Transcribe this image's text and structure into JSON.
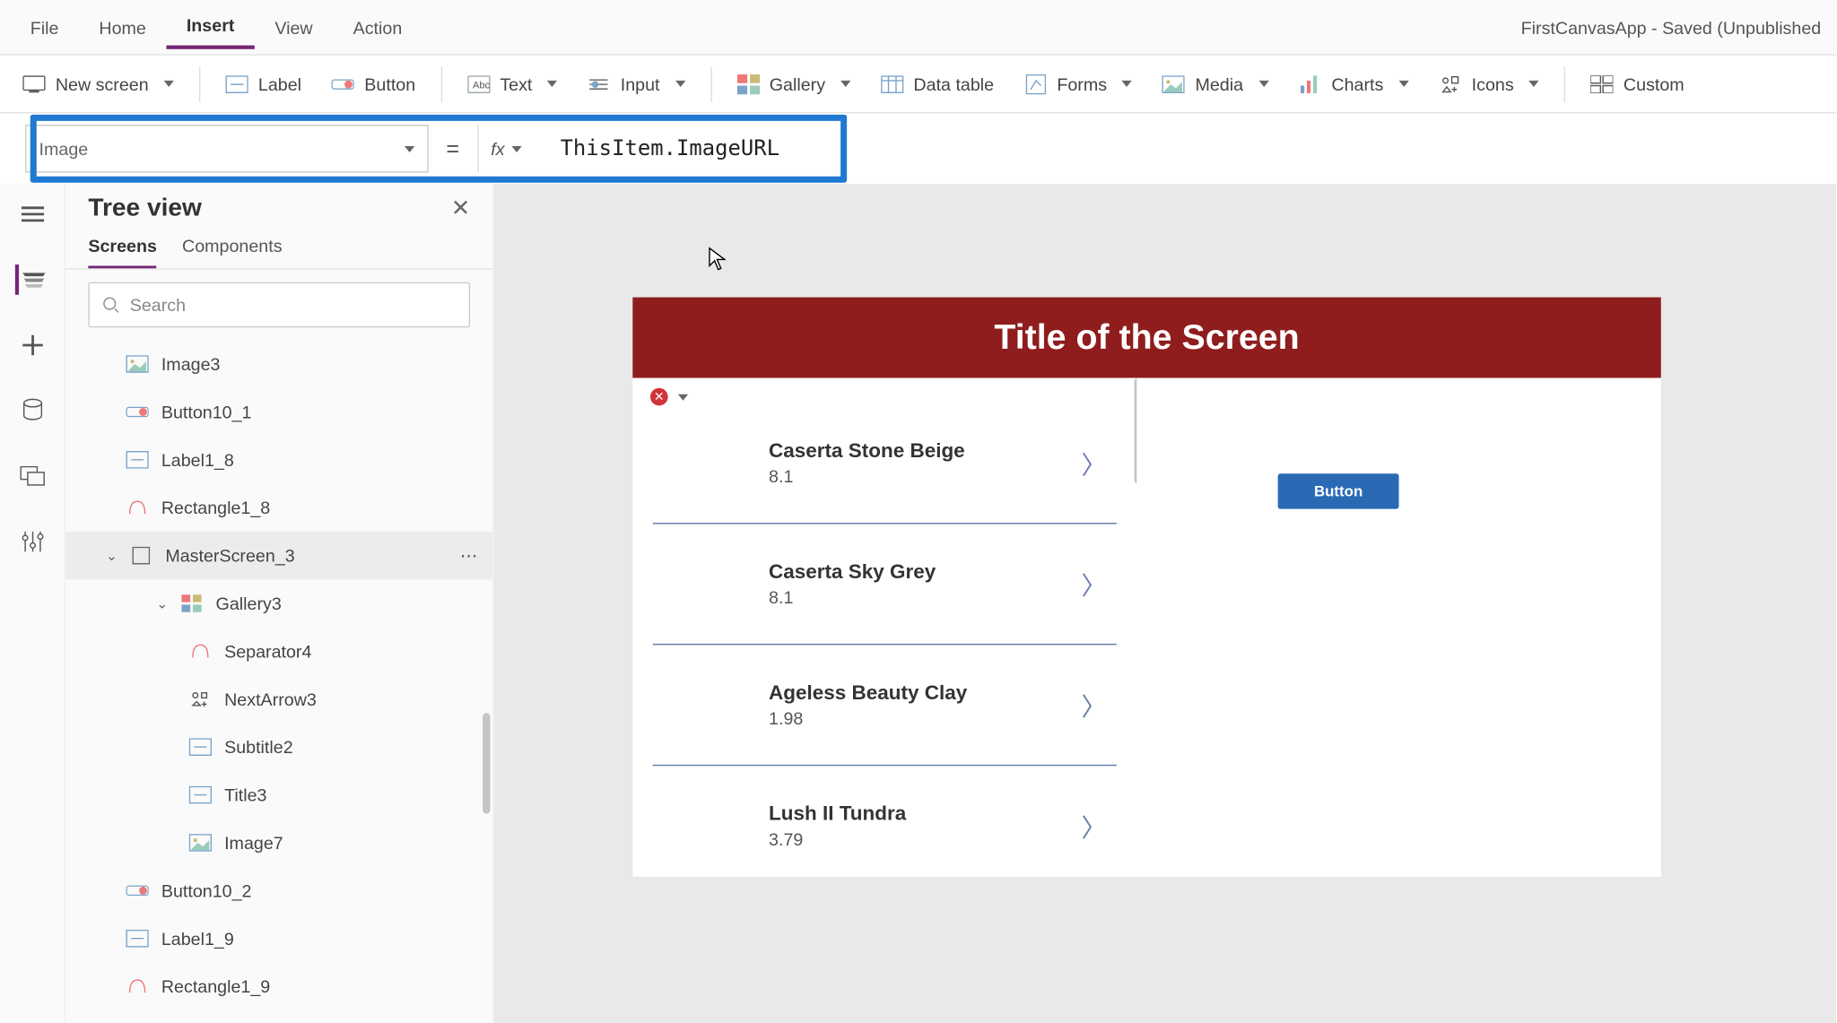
{
  "app_title": "FirstCanvasApp - Saved (Unpublished",
  "menubar": {
    "file": "File",
    "home": "Home",
    "insert": "Insert",
    "view": "View",
    "action": "Action",
    "active": "Insert"
  },
  "ribbon": {
    "new_screen": "New screen",
    "label": "Label",
    "button": "Button",
    "text": "Text",
    "input": "Input",
    "gallery": "Gallery",
    "data_table": "Data table",
    "forms": "Forms",
    "media": "Media",
    "charts": "Charts",
    "icons": "Icons",
    "custom": "Custom"
  },
  "formula_bar": {
    "property": "Image",
    "equals": "=",
    "fx": "fx",
    "formula": "ThisItem.ImageURL"
  },
  "rail": {
    "menu": "menu",
    "layers": "layers",
    "add": "add",
    "data": "data",
    "screen": "screen",
    "settings": "settings"
  },
  "tree_view": {
    "title": "Tree view",
    "tab_screens": "Screens",
    "tab_components": "Components",
    "search_placeholder": "Search",
    "nodes": [
      {
        "name": "Image3",
        "icon": "image",
        "indent": "indent1"
      },
      {
        "name": "Button10_1",
        "icon": "button",
        "indent": "indent1"
      },
      {
        "name": "Label1_8",
        "icon": "label",
        "indent": "indent1"
      },
      {
        "name": "Rectangle1_8",
        "icon": "shape",
        "indent": "indent1"
      },
      {
        "name": "MasterScreen_3",
        "icon": "screen",
        "indent": "indent2",
        "caret": true,
        "selected": true,
        "more": true
      },
      {
        "name": "Gallery3",
        "icon": "gallery",
        "indent": "indent3",
        "caret": true
      },
      {
        "name": "Separator4",
        "icon": "shape",
        "indent": "indent4"
      },
      {
        "name": "NextArrow3",
        "icon": "nexticon",
        "indent": "indent4"
      },
      {
        "name": "Subtitle2",
        "icon": "label",
        "indent": "indent4"
      },
      {
        "name": "Title3",
        "icon": "label",
        "indent": "indent4"
      },
      {
        "name": "Image7",
        "icon": "image",
        "indent": "indent4"
      },
      {
        "name": "Button10_2",
        "icon": "button",
        "indent": "indent1"
      },
      {
        "name": "Label1_9",
        "icon": "label",
        "indent": "indent1"
      },
      {
        "name": "Rectangle1_9",
        "icon": "shape",
        "indent": "indent1"
      }
    ]
  },
  "canvas": {
    "header_title": "Title of the Screen",
    "button_label": "Button",
    "error_mark": "✕",
    "gallery_items": [
      {
        "title": "Caserta Stone Beige",
        "subtitle": "8.1"
      },
      {
        "title": "Caserta Sky Grey",
        "subtitle": "8.1"
      },
      {
        "title": "Ageless Beauty Clay",
        "subtitle": "1.98"
      },
      {
        "title": "Lush II Tundra",
        "subtitle": "3.79"
      }
    ]
  },
  "colors": {
    "accent_purple": "#742774",
    "highlight_blue": "#1f78d1",
    "header_red": "#8f1d1d",
    "button_blue": "#2a6ab5"
  }
}
